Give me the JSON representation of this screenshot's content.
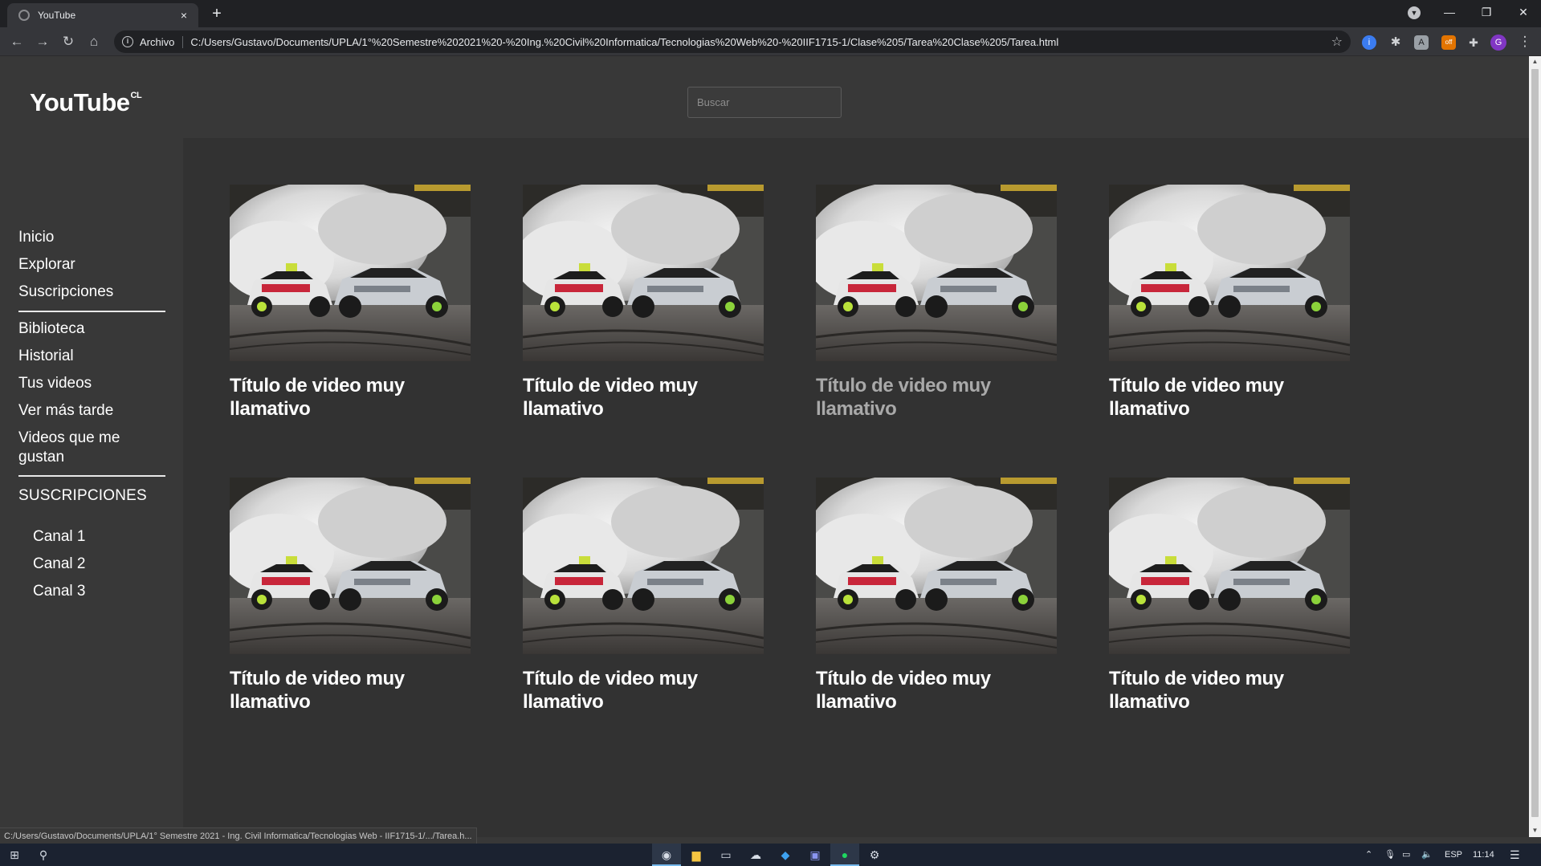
{
  "browser": {
    "tab_title": "YouTube",
    "tab_close": "×",
    "new_tab": "+",
    "origin_chip": "Archivo",
    "url": "C:/Users/Gustavo/Documents/UPLA/1°%20Semestre%202021%20-%20Ing.%20Civil%20Informatica/Tecnologias%20Web%20-%20IIF1715-1/Clase%205/Tarea%20Clase%205/Tarea.html",
    "avatar_letter": "G",
    "status_url": "C:/Users/Gustavo/Documents/UPLA/1° Semestre 2021 - Ing. Civil Informatica/Tecnologias Web - IIF1715-1/.../Tarea.h..."
  },
  "header": {
    "logo": "YouTube",
    "logo_sup": "CL",
    "search_placeholder": "Buscar"
  },
  "sidebar": {
    "main": [
      "Inicio",
      "Explorar",
      "Suscripciones"
    ],
    "library": [
      "Biblioteca",
      "Historial",
      "Tus videos",
      "Ver más tarde",
      "Videos que me gustan"
    ],
    "subs_title": "SUSCRIPCIONES",
    "channels": [
      "Canal 1",
      "Canal 2",
      "Canal 3"
    ]
  },
  "videos": [
    {
      "title": "Título de video muy llamativo",
      "dim": false
    },
    {
      "title": "Título de video muy llamativo",
      "dim": false
    },
    {
      "title": "Título de video muy llamativo",
      "dim": true
    },
    {
      "title": "Título de video muy llamativo",
      "dim": false
    },
    {
      "title": "Título de video muy llamativo",
      "dim": false
    },
    {
      "title": "Título de video muy llamativo",
      "dim": false
    },
    {
      "title": "Título de video muy llamativo",
      "dim": false
    },
    {
      "title": "Título de video muy llamativo",
      "dim": false
    }
  ],
  "thumbnail": {
    "description_icon": "drift-cars-thumbnail"
  },
  "taskbar": {
    "lang": "ESP",
    "time": "11:14"
  }
}
